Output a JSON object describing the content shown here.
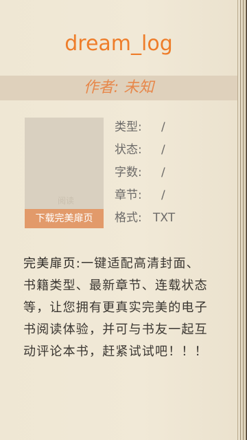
{
  "book": {
    "title": "dream_log",
    "author": "作者: 未知",
    "cover_watermark": "阅读",
    "cover_button": "下载完美扉页"
  },
  "meta": [
    {
      "key": "类型:",
      "value": "/"
    },
    {
      "key": "状态:",
      "value": "/"
    },
    {
      "key": "字数:",
      "value": "/"
    },
    {
      "key": "章节:",
      "value": "/"
    },
    {
      "key": "格式:",
      "value": "TXT"
    }
  ],
  "description": {
    "lead": "完美扉页:",
    "body": "一键适配高清封面、书籍类型、最新章节、连载状态等，让您拥有更真实完美的电子书阅读体验，并可与书友一起互动评论本书，赶紧试试吧！！！"
  },
  "colors": {
    "accent": "#ee7d2a",
    "author": "#e7874a",
    "button": "#e29a6a",
    "paper": "#efe7d4",
    "band": "#dfd1bc"
  }
}
